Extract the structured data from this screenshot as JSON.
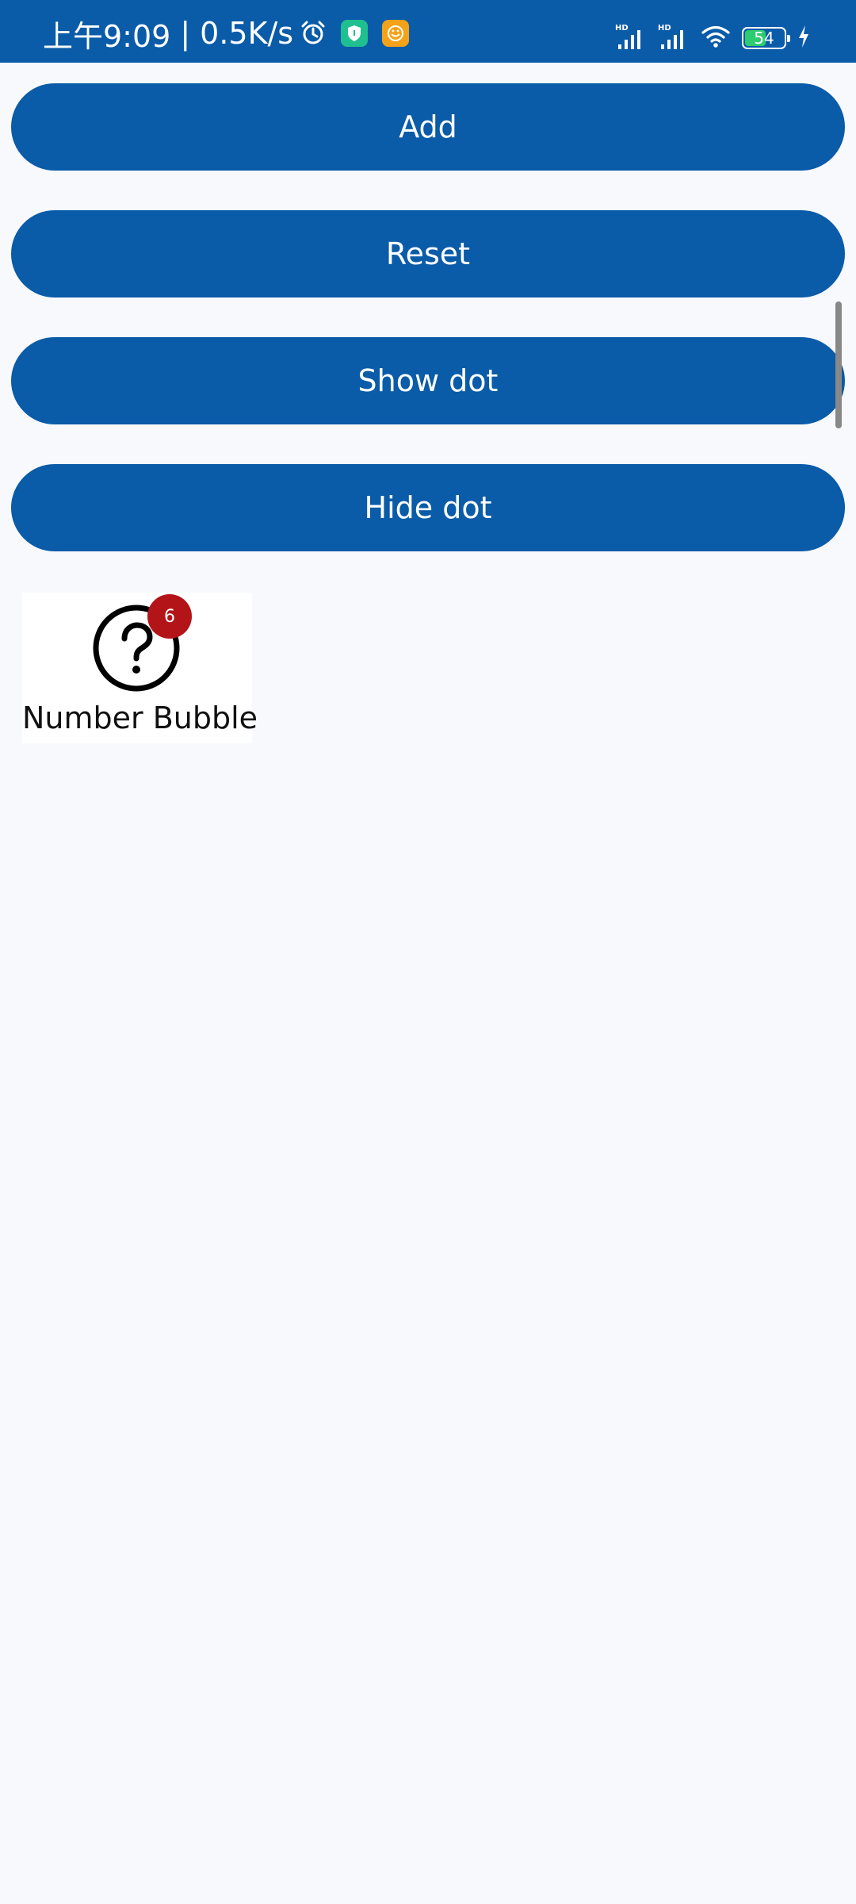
{
  "status_bar": {
    "time_text": "上午9:09",
    "speed_text": "0.5K/s",
    "separator": "|",
    "battery_level": "54",
    "icons": [
      "alarm-icon",
      "shield-app-icon",
      "face-app-icon",
      "hd-signal-icon",
      "hd-signal-icon",
      "wifi-icon",
      "battery-icon",
      "charging-icon"
    ]
  },
  "buttons": {
    "add_label": "Add",
    "reset_label": "Reset",
    "show_dot_label": "Show dot",
    "hide_dot_label": "Hide dot"
  },
  "bubble": {
    "count": "6",
    "label": "Number Bubble",
    "icon": "question-circle-icon"
  },
  "colors": {
    "primary": "#0a5ba8",
    "badge": "#b31418",
    "background": "#f8f9fc"
  }
}
